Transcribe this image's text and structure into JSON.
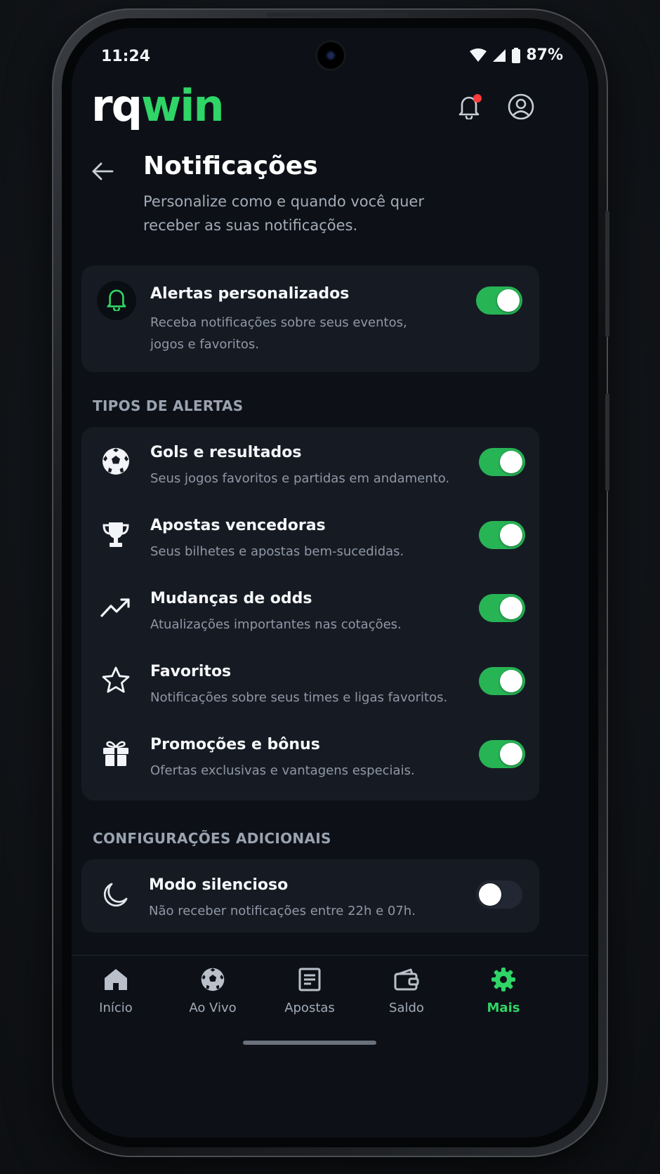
{
  "status_bar": {
    "time": "11:24",
    "battery": "87%",
    "icons": [
      "wifi-icon",
      "signal-icon",
      "battery-icon"
    ]
  },
  "header": {
    "logo_part1": "rq",
    "logo_part2": "win",
    "icons": [
      "bell-icon",
      "profile-icon"
    ],
    "notification_dot_color": "#ff3b3b"
  },
  "page": {
    "title": "Notificações",
    "subtitle": "Personalize como e quando você quer receber as suas notificações."
  },
  "master": {
    "title": "Alertas personalizados",
    "description": "Receba notificações sobre seus eventos, jogos e favoritos.",
    "icon": "bell-icon",
    "enabled": true
  },
  "alert_types": {
    "section_label": "TIPOS DE ALERTAS",
    "items": [
      {
        "title": "Gols e resultados",
        "description": "Seus jogos favoritos e partidas em andamento.",
        "icon": "soccer-ball-icon",
        "enabled": true
      },
      {
        "title": "Apostas vencedoras",
        "description": "Seus bilhetes e apostas bem-sucedidas.",
        "icon": "trophy-icon",
        "enabled": true
      },
      {
        "title": "Mudanças de odds",
        "description": "Atualizações importantes nas cotações.",
        "icon": "trending-up-icon",
        "enabled": true
      },
      {
        "title": "Favoritos",
        "description": "Notificações sobre seus times e ligas favoritos.",
        "icon": "star-icon",
        "enabled": true
      },
      {
        "title": "Promoções e bônus",
        "description": "Ofertas exclusivas e vantagens especiais.",
        "icon": "gift-icon",
        "enabled": true
      }
    ]
  },
  "additional": {
    "section_label": "CONFIGURAÇÕES ADICIONAIS",
    "silent": {
      "title": "Modo silencioso",
      "description": "Não receber notificações entre 22h e 07h.",
      "icon": "moon-icon",
      "enabled": false
    }
  },
  "bottom_nav": {
    "items": [
      {
        "label": "Início",
        "icon": "home-icon",
        "active": false
      },
      {
        "label": "Ao Vivo",
        "icon": "soccer-ball-icon",
        "active": false
      },
      {
        "label": "Apostas",
        "icon": "ticket-icon",
        "active": false
      },
      {
        "label": "Saldo",
        "icon": "wallet-icon",
        "active": false
      },
      {
        "label": "Mais",
        "icon": "gear-icon",
        "active": true
      }
    ]
  },
  "colors": {
    "accent": "#2fd567",
    "toggle_on": "#27b455",
    "background": "#0d1117",
    "card": "#161b23"
  }
}
